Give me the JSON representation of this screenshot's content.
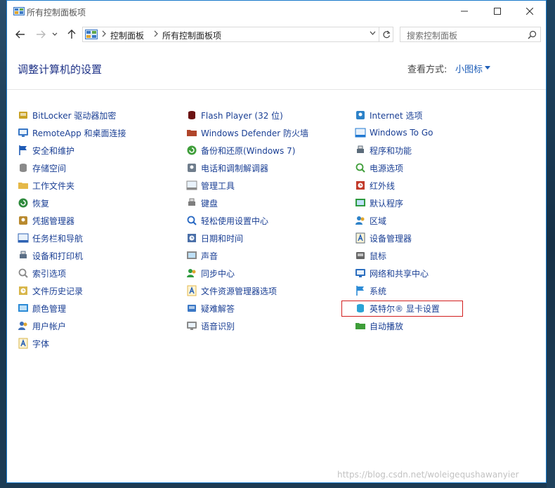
{
  "window": {
    "title": "所有控制面板项",
    "breadcrumb": [
      "控制面板",
      "所有控制面板项"
    ],
    "search_placeholder": "搜索控制面板"
  },
  "header": {
    "title": "调整计算机的设置",
    "view_label": "查看方式:",
    "view_value": "小图标"
  },
  "columns": [
    [
      {
        "label": "BitLocker 驱动器加密",
        "icon": "bitlocker-icon",
        "color": "#c9a227"
      },
      {
        "label": "RemoteApp 和桌面连接",
        "icon": "remoteapp-icon",
        "color": "#3a78c6"
      },
      {
        "label": "安全和维护",
        "icon": "flag-icon",
        "color": "#1f5bb5"
      },
      {
        "label": "存储空间",
        "icon": "storage-icon",
        "color": "#8a8a8a"
      },
      {
        "label": "工作文件夹",
        "icon": "folder-icon",
        "color": "#e5b848"
      },
      {
        "label": "恢复",
        "icon": "recovery-icon",
        "color": "#2f8a3d"
      },
      {
        "label": "凭据管理器",
        "icon": "credential-icon",
        "color": "#b98a2f"
      },
      {
        "label": "任务栏和导航",
        "icon": "taskbar-icon",
        "color": "#2e62b3"
      },
      {
        "label": "设备和打印机",
        "icon": "printer-icon",
        "color": "#5a6e86"
      },
      {
        "label": "索引选项",
        "icon": "index-icon",
        "color": "#8a8a8a"
      },
      {
        "label": "文件历史记录",
        "icon": "file-history-icon",
        "color": "#d8b64a"
      },
      {
        "label": "颜色管理",
        "icon": "color-management-icon",
        "color": "#2c8bd6"
      },
      {
        "label": "用户帐户",
        "icon": "user-accounts-icon",
        "color": "#3f6fb8"
      },
      {
        "label": "字体",
        "icon": "font-icon",
        "color": "#d8b64a"
      }
    ],
    [
      {
        "label": "Flash Player (32 位)",
        "icon": "flash-icon",
        "color": "#6b1313"
      },
      {
        "label": "Windows Defender 防火墙",
        "icon": "firewall-icon",
        "color": "#b0452a"
      },
      {
        "label": "备份和还原(Windows 7)",
        "icon": "backup-icon",
        "color": "#3f9e3a"
      },
      {
        "label": "电话和调制解调器",
        "icon": "modem-icon",
        "color": "#6f7d8c"
      },
      {
        "label": "管理工具",
        "icon": "admin-tools-icon",
        "color": "#8a8a8a"
      },
      {
        "label": "键盘",
        "icon": "keyboard-icon",
        "color": "#7d7d7d"
      },
      {
        "label": "轻松使用设置中心",
        "icon": "ease-of-access-icon",
        "color": "#2566c2"
      },
      {
        "label": "日期和时间",
        "icon": "clock-icon",
        "color": "#4a6fa8"
      },
      {
        "label": "声音",
        "icon": "speaker-icon",
        "color": "#8a8a8a"
      },
      {
        "label": "同步中心",
        "icon": "sync-icon",
        "color": "#2e9a3f"
      },
      {
        "label": "文件资源管理器选项",
        "icon": "folder-options-icon",
        "color": "#e5b848"
      },
      {
        "label": "疑难解答",
        "icon": "troubleshoot-icon",
        "color": "#3a78c6"
      },
      {
        "label": "语音识别",
        "icon": "microphone-icon",
        "color": "#8a8a8a"
      }
    ],
    [
      {
        "label": "Internet 选项",
        "icon": "internet-icon",
        "color": "#2d82c8"
      },
      {
        "label": "Windows To Go",
        "icon": "windows-to-go-icon",
        "color": "#1f78d1"
      },
      {
        "label": "程序和功能",
        "icon": "programs-icon",
        "color": "#5b6b7a"
      },
      {
        "label": "电源选项",
        "icon": "power-icon",
        "color": "#3f9e3a"
      },
      {
        "label": "红外线",
        "icon": "infrared-icon",
        "color": "#c23a2a"
      },
      {
        "label": "默认程序",
        "icon": "default-programs-icon",
        "color": "#2e9a3f"
      },
      {
        "label": "区域",
        "icon": "region-icon",
        "color": "#2d82c8"
      },
      {
        "label": "设备管理器",
        "icon": "device-manager-icon",
        "color": "#5b6b7a"
      },
      {
        "label": "鼠标",
        "icon": "mouse-icon",
        "color": "#666666"
      },
      {
        "label": "网络和共享中心",
        "icon": "network-icon",
        "color": "#2d6fbf"
      },
      {
        "label": "系统",
        "icon": "system-icon",
        "color": "#2c8bd6"
      },
      {
        "label": "英特尔® 显卡设置",
        "icon": "intel-graphics-icon",
        "color": "#2aa3d6"
      },
      {
        "label": "自动播放",
        "icon": "autoplay-icon",
        "color": "#3f9e3a"
      }
    ]
  ],
  "watermark": "https://blog.csdn.net/woleigequshawanyier"
}
